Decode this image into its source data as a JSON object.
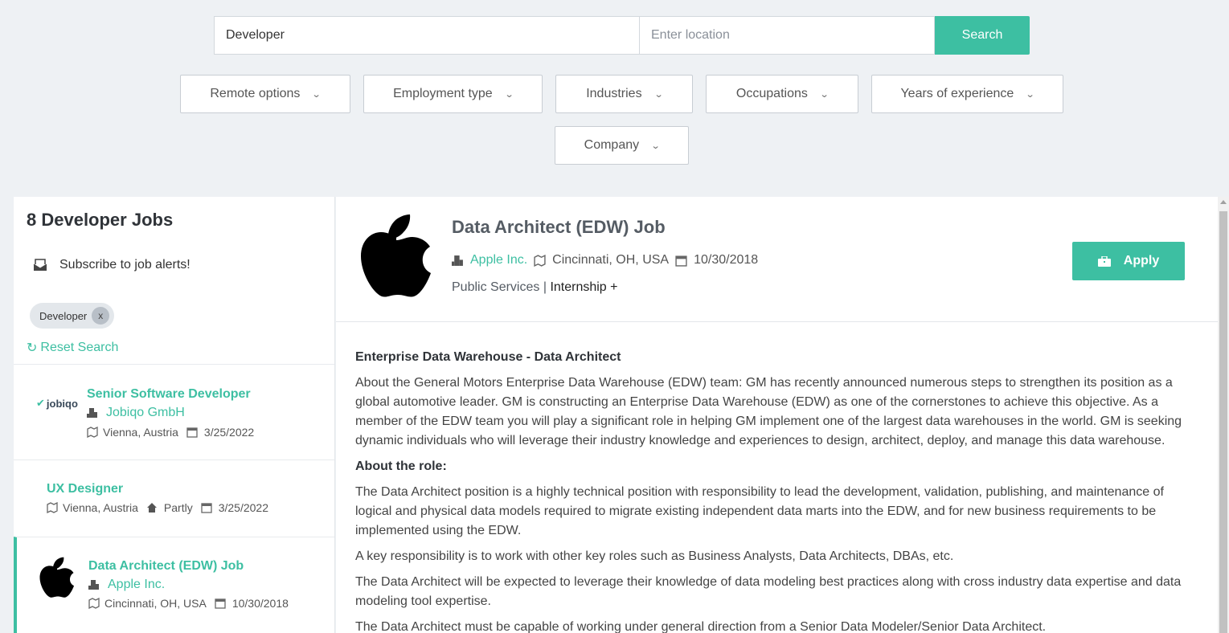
{
  "search": {
    "keyword_value": "Developer",
    "location_placeholder": "Enter location",
    "button_label": "Search"
  },
  "filters": [
    {
      "label": "Remote options"
    },
    {
      "label": "Employment type"
    },
    {
      "label": "Industries"
    },
    {
      "label": "Occupations"
    },
    {
      "label": "Years of experience"
    },
    {
      "label": "Company"
    }
  ],
  "list": {
    "title": "8 Developer Jobs",
    "subscribe_label": "Subscribe to job alerts!",
    "chip_label": "Developer",
    "chip_close": "x",
    "reset_label": "Reset Search",
    "jobs": [
      {
        "title": "Senior Software Developer",
        "company": "Jobiqo GmbH",
        "location": "Vienna, Austria",
        "date": "3/25/2022",
        "logo_text": "jobiqo"
      },
      {
        "title": "UX Designer",
        "location": "Vienna, Austria",
        "remote": "Partly",
        "date": "3/25/2022"
      },
      {
        "title": "Data Architect (EDW) Job",
        "company": "Apple Inc.",
        "location": "Cincinnati, OH, USA",
        "date": "10/30/2018"
      }
    ]
  },
  "detail": {
    "title": "Data Architect (EDW) Job",
    "company": "Apple Inc.",
    "location": "Cincinnati, OH, USA",
    "date": "10/30/2018",
    "industry": "Public Services",
    "separator": "|",
    "employment": "Internship +",
    "apply_label": "Apply",
    "description": {
      "heading1": "Enterprise Data Warehouse - Data Architect",
      "p1": "About the General Motors Enterprise Data Warehouse (EDW) team: GM has recently announced numerous steps to strengthen its position as a global automotive leader. GM is constructing an Enterprise Data Warehouse (EDW) as one of the cornerstones to achieve this objective. As a member of the EDW team you will play a significant role in helping GM implement one of the largest data warehouses in the world. GM is seeking dynamic individuals who will leverage their industry knowledge and experiences to design, architect, deploy, and manage this data warehouse.",
      "heading2": "About the role:",
      "p2": "The Data Architect position is a highly technical position with responsibility to lead the development, validation, publishing, and maintenance of logical and physical data models required to migrate existing independent data marts into the EDW, and for new business requirements to be implemented using the EDW.",
      "p3": "A key responsibility is to work with other key roles such as Business Analysts, Data Architects, DBAs, etc.",
      "p4": "The Data Architect will be expected to leverage their knowledge of data modeling best practices along with cross industry data expertise and data modeling tool expertise.",
      "p5": "The Data Architect must be capable of working under general direction from a Senior Data Modeler/Senior Data Architect."
    }
  },
  "colors": {
    "accent": "#3dbfa2",
    "background": "#eef1f4"
  }
}
